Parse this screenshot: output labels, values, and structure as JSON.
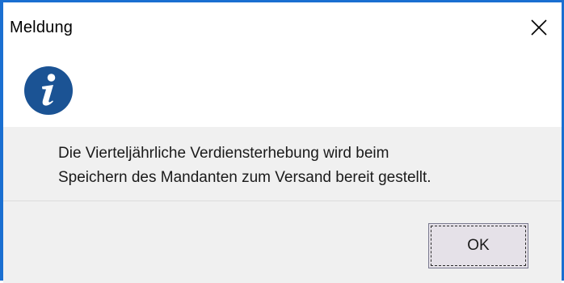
{
  "window": {
    "title": "Meldung",
    "close_icon": "close-icon"
  },
  "dialog": {
    "icon": "info-icon",
    "icon_color": "#1b5394",
    "message_line1": "Die Vierteljährliche Verdiensterhebung wird beim",
    "message_line2": "Speichern des Mandanten zum Versand bereit gestellt."
  },
  "buttons": {
    "ok_label": "OK"
  },
  "colors": {
    "window_border": "#1a6fd1",
    "content_background": "#f0f0f0",
    "button_background": "#e5e1e8"
  }
}
